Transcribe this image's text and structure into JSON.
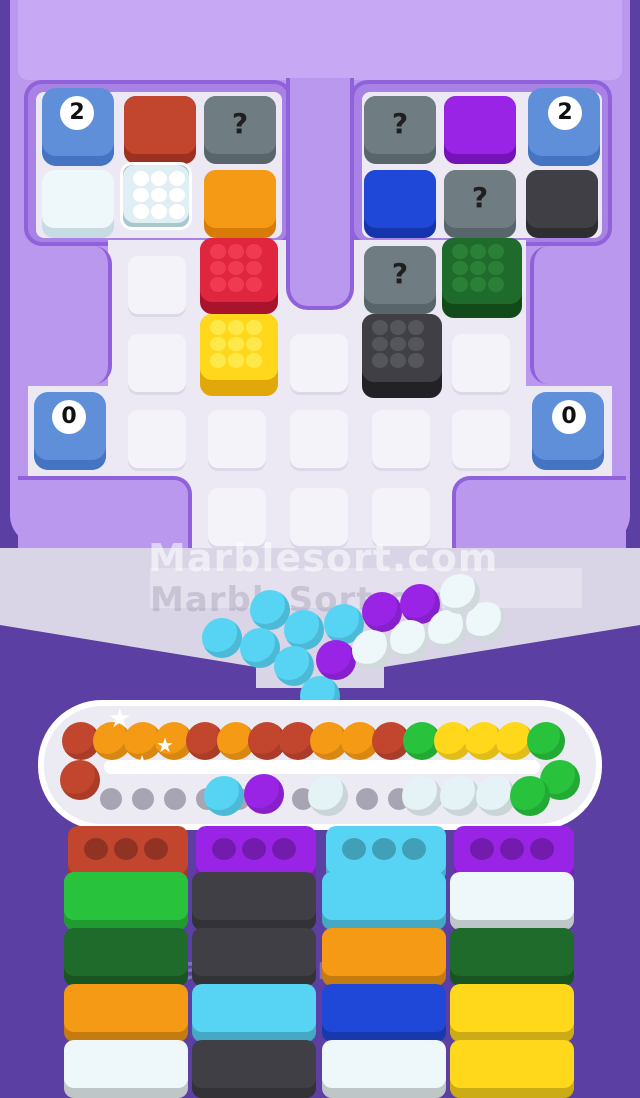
{
  "counters": {
    "top_left": "2",
    "top_right": "2",
    "mid_left": "0",
    "mid_right": "0"
  },
  "mystery_symbol": "?",
  "watermark": {
    "primary": "Marblesort.com",
    "secondary": "MarbleSort.com"
  },
  "colors": {
    "board": "#b998ee",
    "rust": "#c2452e",
    "white": "#eef8fb",
    "orange": "#f59a15",
    "red": "#e0253f",
    "yellow": "#ffd81c",
    "blue": "#1f48d9",
    "purple": "#9a24e6",
    "darkgray": "#3f3f45",
    "darkgreen": "#1f6b2b",
    "green": "#28c23d",
    "cyan": "#57d4f4",
    "mystery": "#6f7c82"
  },
  "queue_sequence": [
    "rust",
    "orange",
    "orange",
    "orange",
    "rust",
    "orange",
    "rust",
    "rust",
    "orange",
    "orange",
    "rust",
    "green",
    "yellow",
    "yellow",
    "yellow",
    "green"
  ],
  "tube_tops": [
    "rust",
    "purple",
    "cyan",
    "purple"
  ],
  "stacks": [
    [
      "green",
      "darkgreen",
      "orange",
      "white"
    ],
    [
      "darkgray",
      "darkgray",
      "cyan",
      "darkgray"
    ],
    [
      "cyan",
      "orange",
      "blue",
      "white"
    ],
    [
      "white",
      "darkgreen",
      "yellow",
      "yellow"
    ]
  ]
}
